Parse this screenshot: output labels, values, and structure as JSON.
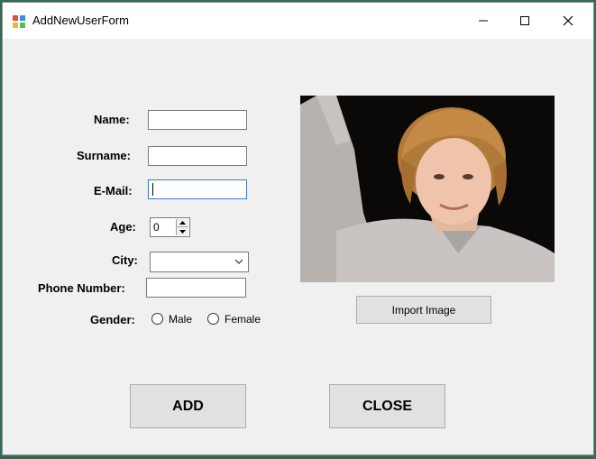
{
  "window": {
    "title": "AddNewUserForm"
  },
  "form": {
    "name_label": "Name:",
    "surname_label": "Surname:",
    "email_label": "E-Mail:",
    "age_label": "Age:",
    "age_value": "0",
    "city_label": "City:",
    "city_value": "",
    "phone_label": "Phone Number:",
    "gender_label": "Gender:",
    "gender_options": [
      "Male",
      "Female"
    ]
  },
  "photo": {
    "import_label": "Import Image"
  },
  "buttons": {
    "add_label": "ADD",
    "close_label": "CLOSE"
  }
}
